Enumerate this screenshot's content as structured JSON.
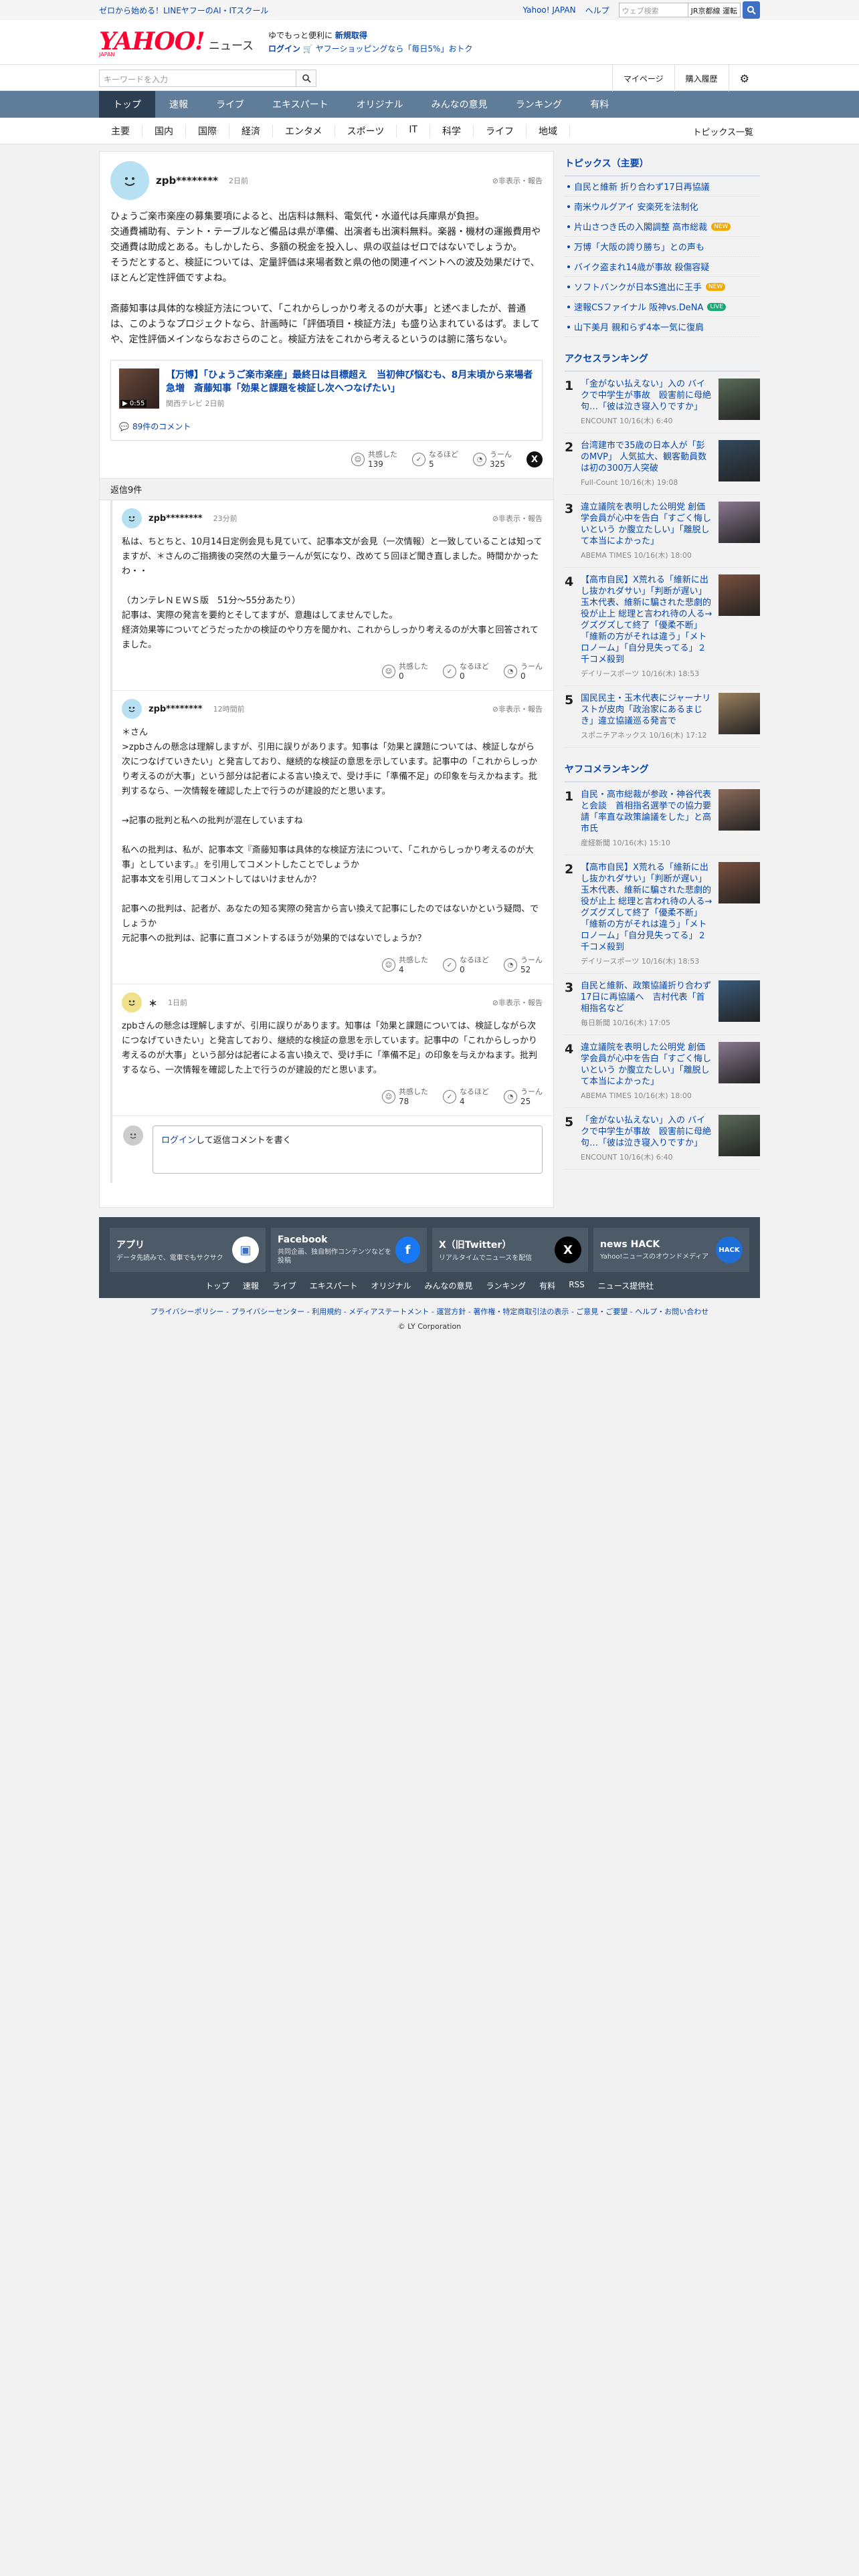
{
  "topbar": {
    "promo": "ゼロから始める！LINEヤフーのAI・ITスクール",
    "links": [
      "Yahoo! JAPAN",
      "ヘルプ"
    ],
    "search_placeholder": "ウェブ検索",
    "search_tag": "JR京都線 運転"
  },
  "header": {
    "logo": "YAHOO!",
    "logo_sub": "JAPAN",
    "logo_news": "ニュース",
    "promo1": "ゆでもっと便利に",
    "promo1_bold": "新規取得",
    "promo2_login": "ログイン",
    "promo2": "ヤフーショッピングなら「毎日5%」おトク"
  },
  "searchrow": {
    "placeholder": "キーワードを入力",
    "mypage": "マイページ",
    "history": "購入履歴"
  },
  "nav": {
    "items": [
      "トップ",
      "速報",
      "ライブ",
      "エキスパート",
      "オリジナル",
      "みんなの意見",
      "ランキング",
      "有料"
    ],
    "active": 0
  },
  "subnav": {
    "items": [
      "主要",
      "国内",
      "国際",
      "経済",
      "エンタメ",
      "スポーツ",
      "IT",
      "科学",
      "ライフ",
      "地域"
    ],
    "topics": "トピックス一覧"
  },
  "comment": {
    "user": "zpb********",
    "time": "2日前",
    "report": "非表示・報告",
    "text": "ひょうご楽市楽座の募集要項によると、出店料は無料、電気代・水道代は兵庫県が負担。\n交通費補助有、テント・テーブルなど備品は県が準備、出演者も出演料無料。楽器・機材の運搬費用や交通費は助成とある。もしかしたら、多額の税金を投入し、県の収益はゼロではないでしょうか。\nそうだとすると、検証については、定量評価は来場者数と県の他の関連イベントへの波及効果だけで、ほとんど定性評価ですよね。\n\n斎藤知事は具体的な検証方法について、「これからしっかり考えるのが大事」と述べましたが、普通は、このようなプロジェクトなら、計画時に「評価項目・検証方法」も盛り込まれているはず。まして や、定性評価メインならなおさらのこと。検証方法をこれから考えるというのは腑に落ちない。",
    "news": {
      "title": "【万博】「ひょうご楽市楽座」最終日は目標超え　当初伸び悩むも、8月末頃から来場者急増　斎藤知事「効果と課題を検証し次へつなげたい」",
      "source": "関西テレビ 2日前",
      "duration": "0:55",
      "count": "89件のコメント"
    },
    "reactions": {
      "agree_label": "共感した",
      "agree": "139",
      "think_label": "なるほど",
      "think": "5",
      "hmm_label": "うーん",
      "hmm": "325"
    }
  },
  "replies_header": "返信9件",
  "replies": [
    {
      "user": "zpb********",
      "time": "23分前",
      "report": "非表示・報告",
      "text": "私は、ちとちと、10月14日定例会見も見ていて、記事本文が会見（一次情報）と一致していることは知ってますが、＊さんのご指摘後の突然の大量ラーんが気になり、改めて５回ほど聞き直しました。時間かかったわ・・\n\n（カンテレＮＥＷＳ版　51分〜55分あたり）\n記事は、実際の発言を要約とそしてますが、意趣はしてませんでした。\n経済効果等についてどうだったかの検証のやり方を聞かれ、これからしっかり考えるのが大事と回答されてました。",
      "agree_label": "共感した",
      "agree": "0",
      "think_label": "なるほど",
      "think": "0",
      "hmm_label": "うーん",
      "hmm": "0"
    },
    {
      "user": "zpb********",
      "time": "12時間前",
      "report": "非表示・報告",
      "text": "＊さん\n>zpbさんの懸念は理解しますが、引用に誤りがあります。知事は「効果と課題については、検証しながら次につなげていきたい」と発言しており、継続的な検証の意思を示しています。記事中の「これからしっかり考えるのが大事」という部分は記者による言い換えで、受け手に「準備不足」の印象を与えかねます。批判するなら、一次情報を確認した上で行うのが建設的だと思います。\n\n→記事の批判と私への批判が混在していますね\n\n私への批判は、私が、記事本文『斎藤知事は具体的な検証方法について、「これからしっかり考えるのが大事」としています。』を引用してコメントしたことでしょうか\n記事本文を引用してコメントしてはいけませんか？\n\n記事への批判は、記者が、あなたの知る実際の発言から言い換えて記事にしたのではないかという疑問、でしょうか\n元記事への批判は、記事に直コメントするほうが効果的ではないでしょうか？",
      "agree_label": "共感した",
      "agree": "4",
      "think_label": "なるほど",
      "think": "0",
      "hmm_label": "うーん",
      "hmm": "52"
    },
    {
      "user": "＊",
      "time": "1日前",
      "report": "非表示・報告",
      "text": "zpbさんの懸念は理解しますが、引用に誤りがあります。知事は「効果と課題については、検証しながら次につなげていきたい」と発言しており、継続的な検証の意思を示しています。記事中の「これからしっかり考えるのが大事」という部分は記者による言い換えで、受け手に「準備不足」の印象を与えかねます。批判するなら、一次情報を確認した上で行うのが建設的だと思います。",
      "agree_label": "共感した",
      "agree": "78",
      "think_label": "なるほど",
      "think": "4",
      "hmm_label": "うーん",
      "hmm": "25"
    }
  ],
  "reply_login": {
    "link": "ログイン",
    "text": "して返信コメントを書く"
  },
  "topics": {
    "title": "トピックス（主要）",
    "items": [
      {
        "t": "自民と維新 折り合わず17日再協議",
        "badge": ""
      },
      {
        "t": "南米ウルグアイ 安楽死を法制化",
        "badge": ""
      },
      {
        "t": "片山さつき氏の入閣調整 高市総裁",
        "badge": "NEW"
      },
      {
        "t": "万博「大阪の誇り勝ち」との声も",
        "badge": ""
      },
      {
        "t": "バイク盗まれ14歳が事故 殺傷容疑",
        "badge": ""
      },
      {
        "t": "ソフトバンクが日本S進出に王手",
        "badge": "NEW"
      },
      {
        "t": "速報CSファイナル 阪神vs.DeNA",
        "badge": "LIVE"
      },
      {
        "t": "山下美月 親和らず4本一気に復肩",
        "badge": ""
      }
    ]
  },
  "access": {
    "title": "アクセスランキング",
    "items": [
      {
        "n": "1",
        "t": "「金がない払えない」入の バイクで中学生が事故　殴害前に母絶句…「彼は泣き寝入りですか」",
        "s": "ENCOUNT 10/16(木) 6:40",
        "c": "#5a6b5a"
      },
      {
        "n": "2",
        "t": "台湾建市で35歳の日本人が「彭のMVP」 人気拡大、観客動員数は初の300万人突破",
        "s": "Full-Count 10/16(木) 19:08",
        "c": "#33495c"
      },
      {
        "n": "3",
        "t": "違立議院を表明した公明党 創価学会員が心中を告白「すごく悔しいという か腹立たしい」「離脱して本当によかった」",
        "s": "ABEMA TIMES 10/16(木) 18:00",
        "c": "#8a7a90"
      },
      {
        "n": "4",
        "t": "【高市自民】X荒れる「維新に出し抜かれダサい」「判断が遅い」玉木代表、維新に騙された悲劇的役が止上 総理と言われ待の人る→グズグズして終了「優柔不断」「維新の方がそれは違う」「メトロノーム」「自分見失ってる」２千コメ殺到",
        "s": "デイリースポーツ 10/16(木) 18:53",
        "c": "#7a5040"
      },
      {
        "n": "5",
        "t": "国民民主・玉木代表にジャーナリストが皮肉「政治家にあるまじき」違立協議巡る発言で",
        "s": "スポニチアネックス 10/16(木) 17:12",
        "c": "#9a8060"
      }
    ]
  },
  "yafuko": {
    "title": "ヤフコメランキング",
    "items": [
      {
        "n": "1",
        "t": "自民・高市総裁が参政・神谷代表と会談　首相指名選挙での協力要請「率直な政策論議をした」と高市氏",
        "s": "産経新聞 10/16(木) 15:10",
        "c": "#8a6a5a"
      },
      {
        "n": "2",
        "t": "【高市自民】X荒れる「維新に出し抜かれダサい」「判断が遅い」玉木代表、維新に騙された悲劇的役が止上 総理と言われ待の人る→グズグズして終了「優柔不断」「維新の方がそれは違う」「メトロノーム」「自分見失ってる」２千コメ殺到",
        "s": "デイリースポーツ 10/16(木) 18:53",
        "c": "#7a5040"
      },
      {
        "n": "3",
        "t": "自民と維新、政策協議折り合わず17日に再協議へ　吉村代表「首相指名など",
        "s": "毎日新聞 10/16(木) 17:05",
        "c": "#3a5a7a"
      },
      {
        "n": "4",
        "t": "違立議院を表明した公明党 創価学会員が心中を告白「すごく悔しいという か腹立たしい」「離脱して本当によかった」",
        "s": "ABEMA TIMES 10/16(木) 18:00",
        "c": "#8a7a90"
      },
      {
        "n": "5",
        "t": "「金がない払えない」入の バイクで中学生が事故　殴害前に母絶句…「彼は泣き寝入りですか」",
        "s": "ENCOUNT 10/16(木) 6:40",
        "c": "#5a6b5a"
      }
    ]
  },
  "footer": {
    "apps": [
      {
        "name": "アプリ",
        "desc": "データ先読みで、電車でもサクサク",
        "color": "#ffffff",
        "glyph": "▣",
        "gcolor": "#3d6fc4"
      },
      {
        "name": "Facebook",
        "desc": "共同企画、独自制作コンテンツなどを投稿",
        "color": "#1877f2",
        "glyph": "f",
        "gcolor": "#ffffff"
      },
      {
        "name": "X（旧Twitter）",
        "desc": "リアルタイムでニュースを配信",
        "color": "#000000",
        "glyph": "X",
        "gcolor": "#ffffff"
      },
      {
        "name": "news HACK",
        "desc": "Yahoo!ニュースのオウンドメディア",
        "color": "#1e6ed8",
        "glyph": "HACK",
        "gcolor": "#ffffff"
      }
    ],
    "links": [
      "トップ",
      "速報",
      "ライブ",
      "エキスパート",
      "オリジナル",
      "みんなの意見",
      "ランキング",
      "有料",
      "RSS",
      "ニュース提供社"
    ],
    "policy": "プライバシーポリシー - プライバシーセンター - 利用規約 - メディアステートメント - 運営方針 - 著作権・特定商取引法の表示 - ご意見・ご要望 - ヘルプ・お問い合わせ",
    "copyright": "© LY Corporation"
  }
}
